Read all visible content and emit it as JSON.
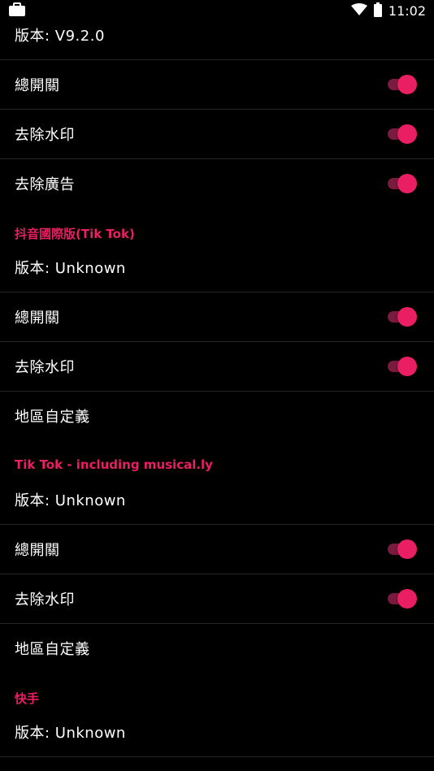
{
  "status_bar": {
    "time": "11:02"
  },
  "colors": {
    "accent": "#e91e63",
    "track": "#7a1a3e",
    "background": "#000000"
  },
  "groups": [
    {
      "header": "",
      "version": "版本: V9.2.0",
      "items": [
        {
          "label": "總開關",
          "toggle": true,
          "on": true
        },
        {
          "label": "去除水印",
          "toggle": true,
          "on": true
        },
        {
          "label": "去除廣告",
          "toggle": true,
          "on": true
        }
      ]
    },
    {
      "header": "抖音國際版(Tik Tok)",
      "version": "版本: Unknown",
      "items": [
        {
          "label": "總開關",
          "toggle": true,
          "on": true
        },
        {
          "label": "去除水印",
          "toggle": true,
          "on": true
        },
        {
          "label": "地區自定義",
          "toggle": false
        }
      ]
    },
    {
      "header": "Tik Tok - including musical.ly",
      "version": "版本: Unknown",
      "items": [
        {
          "label": "總開關",
          "toggle": true,
          "on": true
        },
        {
          "label": "去除水印",
          "toggle": true,
          "on": true
        },
        {
          "label": "地區自定義",
          "toggle": false
        }
      ]
    },
    {
      "header": "快手",
      "version": "版本: Unknown",
      "items": []
    }
  ]
}
